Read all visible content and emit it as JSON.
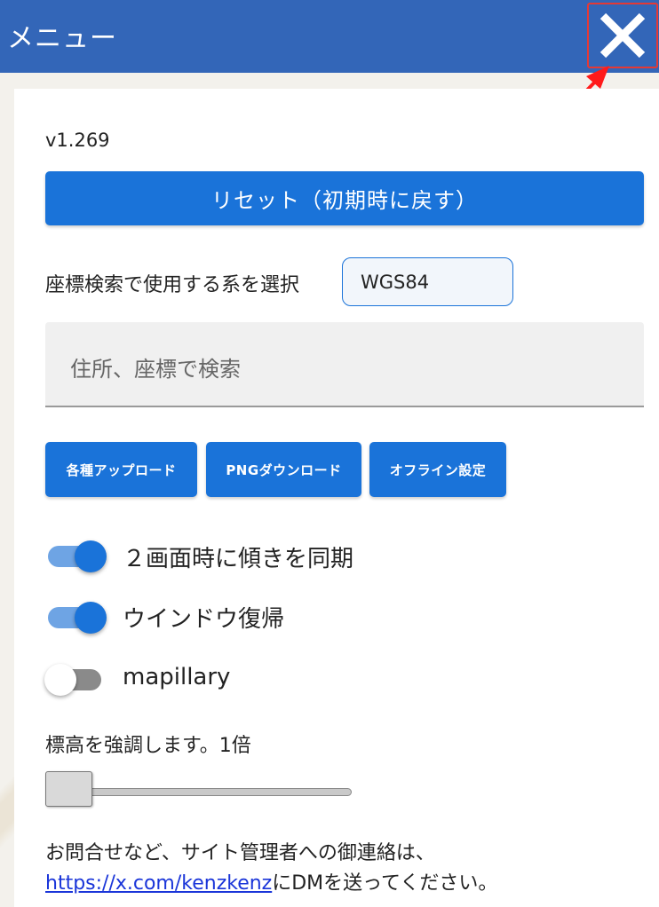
{
  "header": {
    "title": "メニュー",
    "close_icon": "close-icon"
  },
  "panel": {
    "version": "v1.269",
    "reset_button": "リセット（初期時に戻す）",
    "crs": {
      "label": "座標検索で使用する系を選択",
      "selected": "WGS84"
    },
    "search": {
      "placeholder": "住所、座標で検索"
    },
    "buttons": [
      {
        "label": "各種アップロード"
      },
      {
        "label": "PNGダウンロード"
      },
      {
        "label": "オフライン設定"
      }
    ],
    "toggles": [
      {
        "label": "２画面時に傾きを同期",
        "on": true
      },
      {
        "label": "ウインドウ復帰",
        "on": true
      },
      {
        "label": "mapillary",
        "on": false
      }
    ],
    "elevation": {
      "label": "標高を強調します。1倍",
      "value": 1
    },
    "contact": {
      "prefix": "お問合せなど、サイト管理者への御連絡は、",
      "link": "https://x.com/kenzkenz",
      "suffix": "にDMを送ってください。"
    }
  },
  "colors": {
    "header": "#3366b8",
    "button": "#1a73d9",
    "highlight": "#e53935"
  }
}
